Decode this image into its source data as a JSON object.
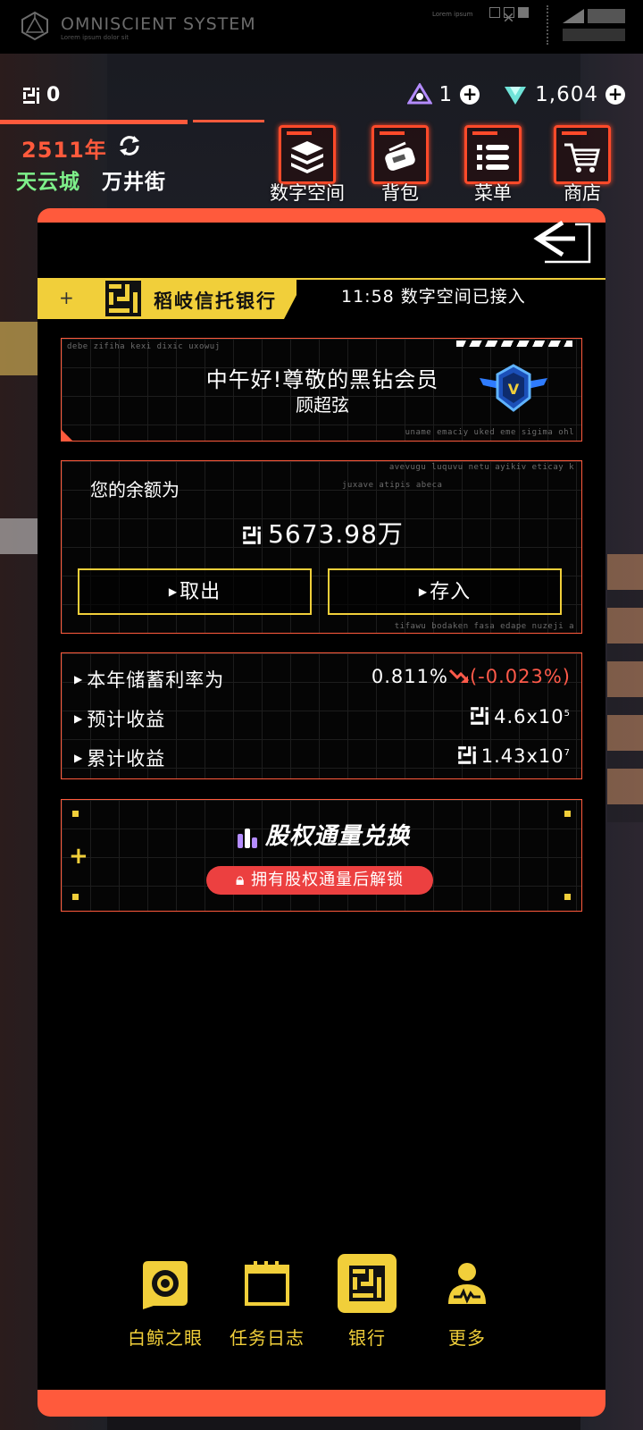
{
  "system": {
    "title": "OMNISCIENT SYSTEM",
    "subtitle": "Lorem ipsum dolor sit",
    "corner_text": "Lorem ipsum"
  },
  "currencies": {
    "coin": "0",
    "crystal": "1",
    "gem": "1,604"
  },
  "world": {
    "year": "2511年",
    "city": "天云城",
    "street": "万井街"
  },
  "top_nav": [
    {
      "label": "数字空间",
      "icon": "stack-layers-icon"
    },
    {
      "label": "背包",
      "icon": "satchel-icon"
    },
    {
      "label": "菜单",
      "icon": "menu-list-icon"
    },
    {
      "label": "商店",
      "icon": "shopping-cart-icon"
    }
  ],
  "bank": {
    "name": "稻岐信托银行",
    "status": "11:58 数字空间已接入"
  },
  "greeting": {
    "line1": "中午好!尊敬的黑钻会员",
    "name": "顾超弦",
    "tiny_top": "debe zifiha kexi dixic uxowuj",
    "tiny_bottom": "uname emaciy uked eme sigima ohl"
  },
  "balance": {
    "label": "您的余额为",
    "amount": "5673.98万",
    "withdraw": "取出",
    "deposit": "存入",
    "tiny_top1": "avevugu luquvu netu ayikiv eticay k",
    "tiny_top2": "juxave atipis abeca",
    "tiny_bottom": "tifawu bodaken fasa edape nuzeji a"
  },
  "rates": {
    "rate_label": "本年储蓄利率为",
    "rate_value": "0.811%",
    "rate_change": "(-0.023%)",
    "expected_label": "预计收益",
    "expected_base": "4.6x10",
    "expected_exp": "5",
    "total_label": "累计收益",
    "total_base": "1.43x10",
    "total_exp": "7"
  },
  "equity": {
    "title": "股权通量兑换",
    "lock_text": "拥有股权通量后解锁"
  },
  "bottom_tabs": [
    {
      "label": "白鲸之眼",
      "icon": "eye-camera-icon",
      "active": false
    },
    {
      "label": "任务日志",
      "icon": "calendar-icon",
      "active": false
    },
    {
      "label": "银行",
      "icon": "bank-logo-icon",
      "active": true
    },
    {
      "label": "更多",
      "icon": "person-more-icon",
      "active": false
    }
  ],
  "colors": {
    "accent_orange": "#ff5a3c",
    "accent_yellow": "#f1cf3a",
    "city_green": "#7ef08a",
    "negative_red": "#ff5a4a"
  }
}
